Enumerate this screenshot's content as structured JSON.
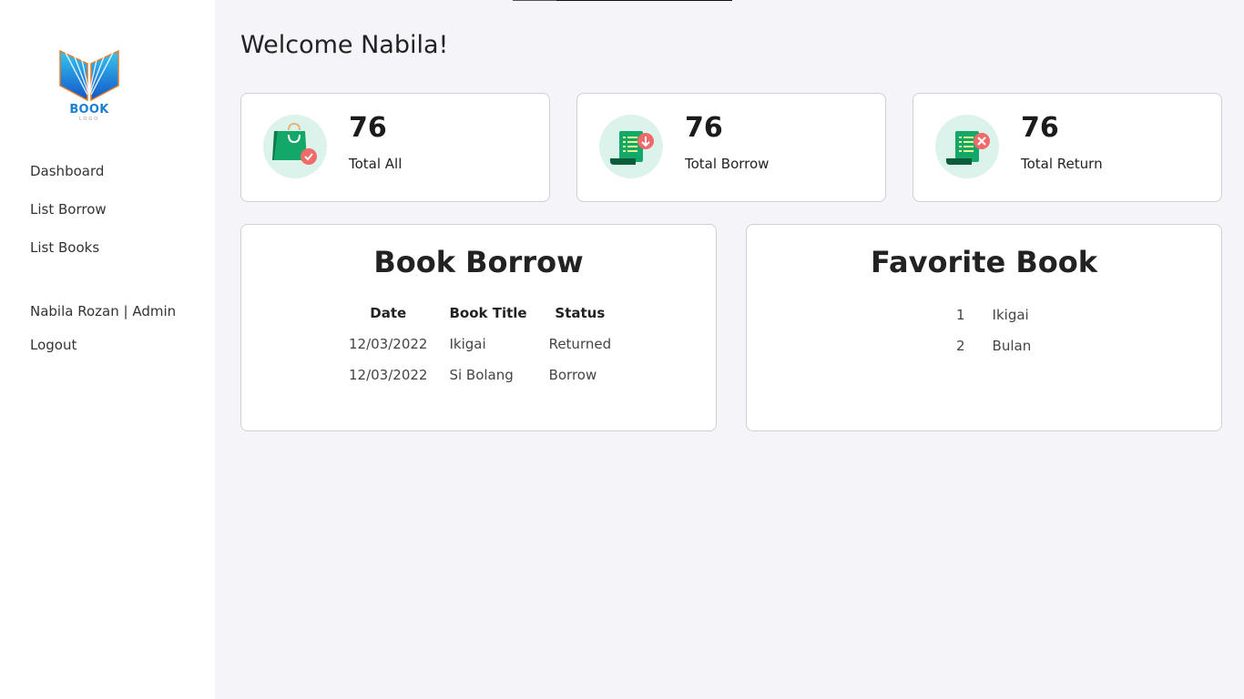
{
  "brand": {
    "logo_text": "BOOK",
    "logo_sub": "LOGO"
  },
  "sidebar": {
    "items": [
      {
        "label": "Dashboard"
      },
      {
        "label": "List Borrow"
      },
      {
        "label": "List Books"
      }
    ],
    "user": "Nabila Rozan | Admin",
    "logout": "Logout"
  },
  "main": {
    "welcome": "Welcome Nabila!"
  },
  "stats": [
    {
      "value": "76",
      "label": "Total All",
      "icon": "shopping-bag-check-icon"
    },
    {
      "value": "76",
      "label": "Total Borrow",
      "icon": "receipt-download-icon"
    },
    {
      "value": "76",
      "label": "Total Return",
      "icon": "receipt-cancel-icon"
    }
  ],
  "book_borrow": {
    "title": "Book Borrow",
    "columns": [
      "Date",
      "Book Title",
      "Status"
    ],
    "rows": [
      {
        "date": "12/03/2022",
        "title": "Ikigai",
        "status": "Returned"
      },
      {
        "date": "12/03/2022",
        "title": "Si Bolang",
        "status": "Borrow"
      }
    ]
  },
  "favorite_book": {
    "title": "Favorite Book",
    "rows": [
      {
        "rank": "1",
        "title": "Ikigai"
      },
      {
        "rank": "2",
        "title": "Bulan"
      }
    ]
  },
  "colors": {
    "sidebar_bg": "#ffffff",
    "page_bg": "#f5f5f9",
    "icon_circle": "#dbf3ea",
    "icon_green": "#13a869",
    "icon_red": "#f06a6a",
    "logo_blue": "#1d7fd1"
  }
}
